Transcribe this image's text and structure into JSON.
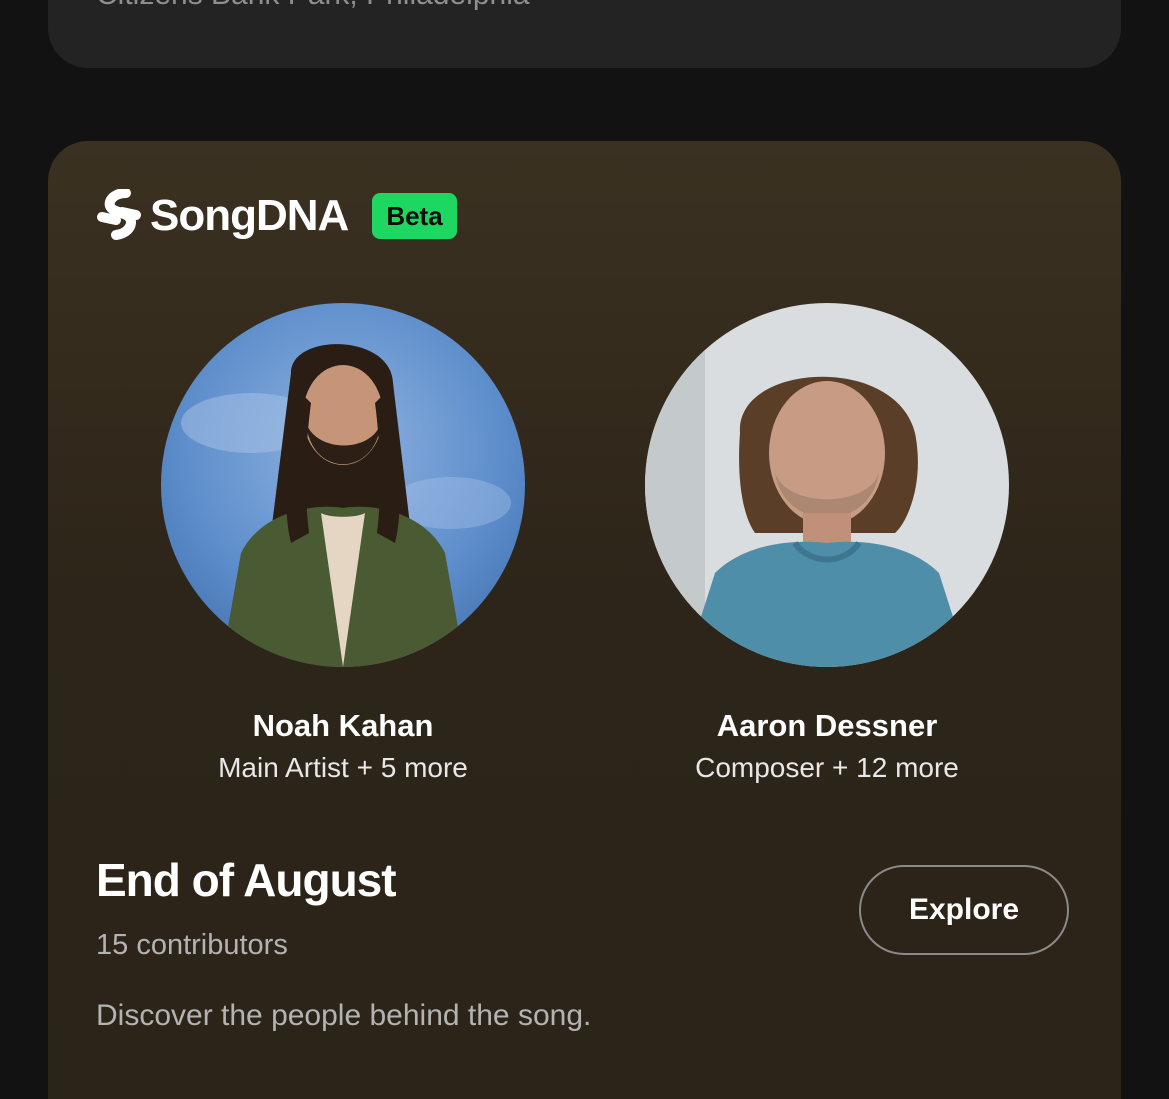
{
  "previous_card": {
    "venue": "Citizens Bank Park, Philadelphia"
  },
  "songdna": {
    "brand": "SongDNA",
    "badge": "Beta",
    "badge_color": "#1ed760",
    "logo_icon": "songdna-logo-icon",
    "artists": [
      {
        "name": "Noah Kahan",
        "role": "Main Artist + 5 more",
        "avatar": "artist-photo"
      },
      {
        "name": "Aaron Dessner",
        "role": "Composer + 12 more",
        "avatar": "artist-photo"
      }
    ],
    "song_title": "End of August",
    "contributors": "15 contributors",
    "tagline": "Discover the people behind the song.",
    "explore_label": "Explore"
  }
}
